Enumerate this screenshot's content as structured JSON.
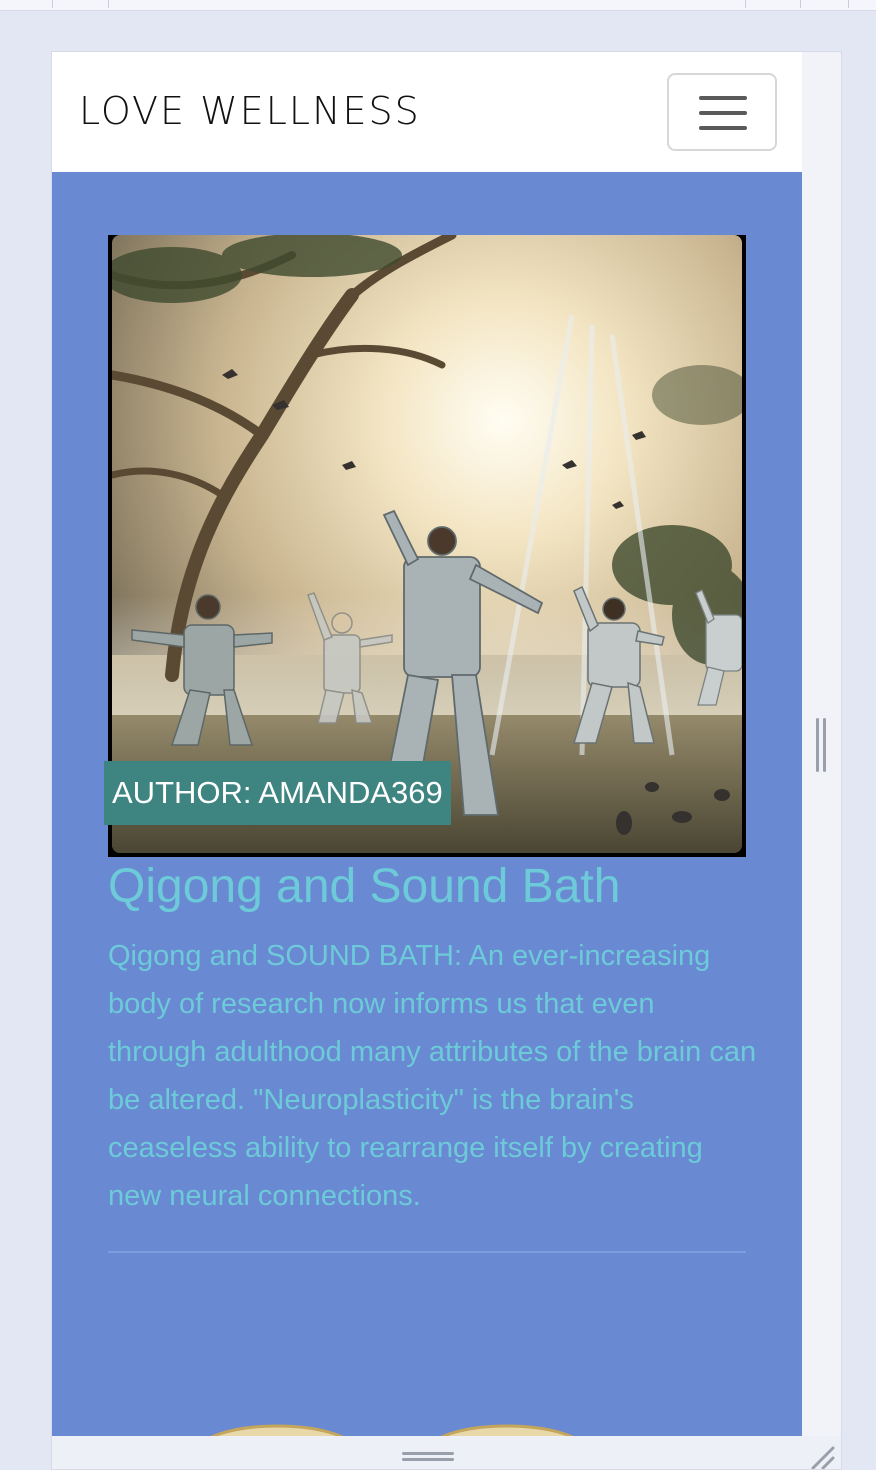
{
  "navbar": {
    "brand": "LOVE WELLNESS",
    "toggle_icon": "hamburger-menu-icon"
  },
  "post": {
    "author_label": "AUTHOR: AMANDA369",
    "title": "Qigong and Sound Bath",
    "excerpt": "Qigong and SOUND BATH: An ever-increasing body of research now informs us that even through adulthood many attributes of the brain can be altered. \"Neuroplasticity\" is the brain's ceaseless ability to rearrange itself by creating new neural connections.",
    "image_subject": "people practicing qigong in a misty sunlit park"
  },
  "colors": {
    "page_background": "#6989d2",
    "text_accent": "#6dcad8",
    "author_badge": "#3e8480",
    "navbar": "#ffffff"
  }
}
